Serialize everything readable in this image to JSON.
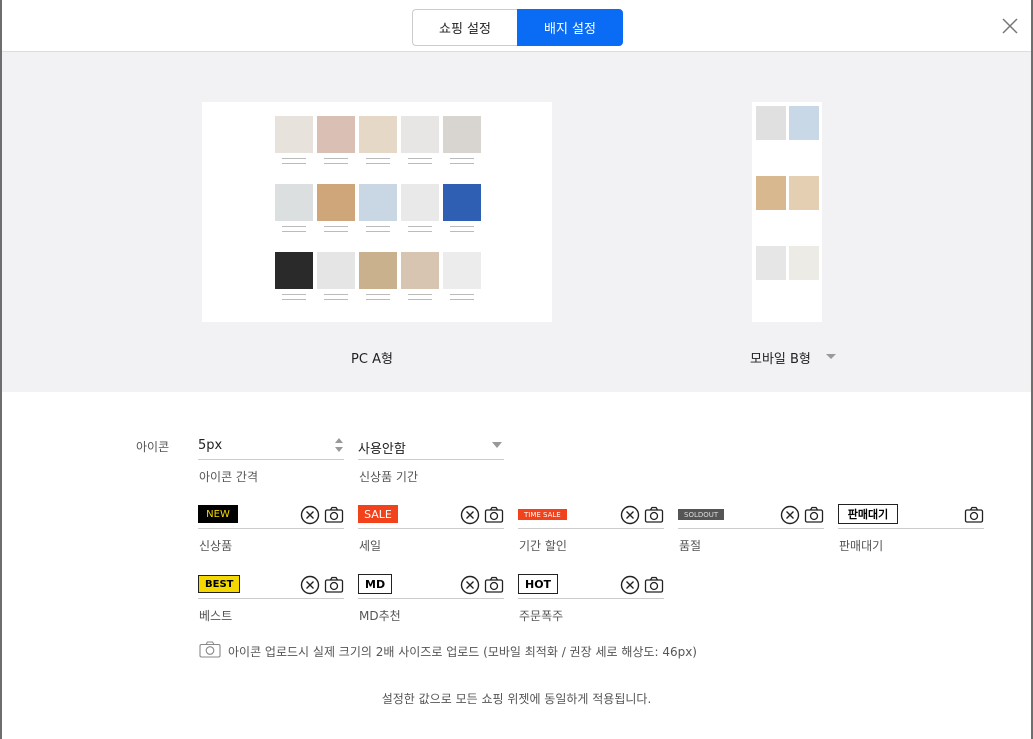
{
  "tabs": [
    {
      "label": "쇼핑 설정"
    },
    {
      "label": "배지 설정"
    }
  ],
  "preview": {
    "pc_label": "PC A형",
    "mobile_label": "모바일 B형"
  },
  "icon_section": {
    "label": "아이콘",
    "spacing_value": "5px",
    "spacing_caption": "아이콘 간격",
    "new_period_value": "사용안함",
    "new_period_caption": "신상품 기간"
  },
  "badges": [
    {
      "badge_text": "NEW",
      "caption": "신상품",
      "bg": "#000000",
      "fg": "#f5d800"
    },
    {
      "badge_text": "SALE",
      "caption": "세일",
      "bg": "#f2421b",
      "fg": "#ffffff"
    },
    {
      "badge_text": "TIME SALE",
      "caption": "기간 할인",
      "bg": "#f2421b",
      "fg": "#ffffff"
    },
    {
      "badge_text": "SOLDOUT",
      "caption": "품절",
      "bg": "#555555",
      "fg": "#dddddd"
    },
    {
      "badge_text": "판매대기",
      "caption": "판매대기",
      "bg": "#ffffff",
      "fg": "#000000"
    },
    {
      "badge_text": "BEST",
      "caption": "베스트",
      "bg": "#f5d800",
      "fg": "#000000"
    },
    {
      "badge_text": "MD",
      "caption": "MD추천",
      "bg": "#ffffff",
      "fg": "#000000"
    },
    {
      "badge_text": "HOT",
      "caption": "주문폭주",
      "bg": "#ffffff",
      "fg": "#000000"
    }
  ],
  "note": "아이콘 업로드시 실제 크기의 2배 사이즈로 업로드 (모바일 최적화 / 권장 세로 해상도: 46px)",
  "footer_note": "설정한 값으로 모든 쇼핑 위젯에 동일하게 적용됩니다.",
  "colors": {
    "accent": "#0a6cf5",
    "preview_bg": "#f2f2f4"
  }
}
